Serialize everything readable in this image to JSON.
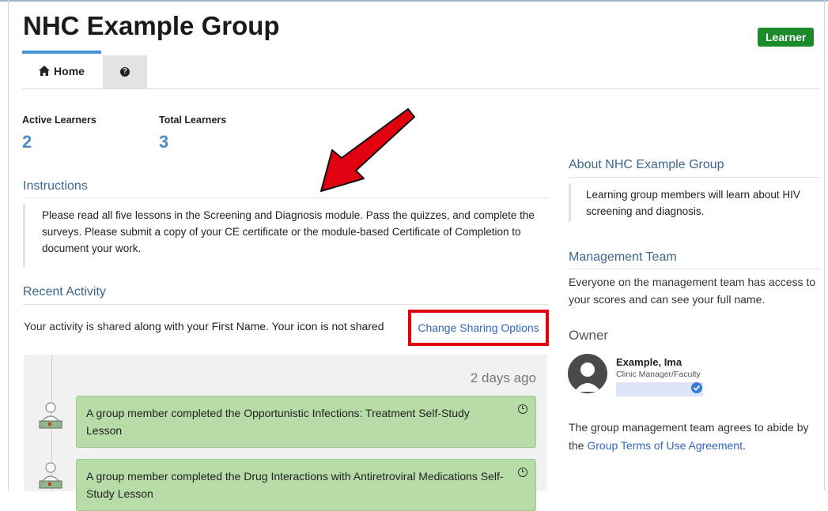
{
  "header": {
    "title": "NHC Example Group",
    "role_badge": "Learner"
  },
  "tabs": [
    {
      "label": "Home",
      "icon": "home-icon"
    },
    {
      "label": "",
      "icon": "question-circle-icon"
    }
  ],
  "stats": {
    "active_label": "Active Learners",
    "active_value": "2",
    "total_label": "Total Learners",
    "total_value": "3"
  },
  "instructions": {
    "heading": "Instructions",
    "body": "Please read all five lessons in the Screening and Diagnosis module. Pass the quizzes, and complete the surveys. Please submit a copy of your CE certificate or the module-based Certificate of Completion to document your work."
  },
  "recent_activity": {
    "heading": "Recent Activity",
    "sharing_text_1": "Your activity is shared",
    "sharing_text_2": "along with your First Name. Your icon is not shared",
    "change_link": "Change Sharing Options",
    "time_label": "2 days ago",
    "items": [
      "A group member completed the Opportunistic Infections: Treatment Self-Study Lesson",
      "A group member completed the Drug Interactions with Antiretroviral Medications Self-Study Lesson"
    ]
  },
  "sidebar": {
    "about_heading": "About NHC Example Group",
    "about_text": "Learning group members will learn about HIV screening and diagnosis.",
    "mgmt_heading": "Management Team",
    "mgmt_text": "Everyone on the management team has access to your scores and can see your full name.",
    "owner_heading": "Owner",
    "owner_name": "Example, Ima",
    "owner_role": "Clinic Manager/Faculty",
    "agree_text": "The group management team agrees to abide by the",
    "agree_link": "Group Terms of Use Agreement",
    "agree_end": "."
  },
  "colors": {
    "accent": "#4a8dc8",
    "badge": "#1a8a2a",
    "highlight": "#e00010",
    "activity_bg": "#b8dca8"
  }
}
